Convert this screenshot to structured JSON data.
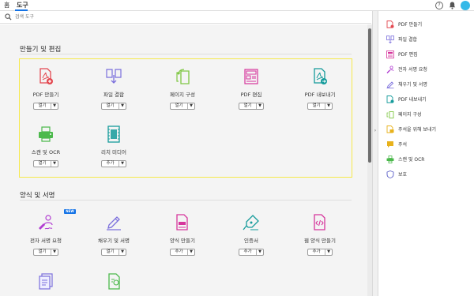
{
  "topbar": {
    "tabs": [
      "홈",
      "도구"
    ],
    "help_symbol": "?",
    "notify_symbol": "🔔"
  },
  "search": {
    "placeholder": "검색 도구"
  },
  "sections": [
    {
      "title": "만들기 및 편집",
      "tools": [
        {
          "label": "PDF 만들기",
          "button": "열기",
          "icon": "create-pdf-icon",
          "color": "#e34850"
        },
        {
          "label": "파일 결합",
          "button": "열기",
          "icon": "combine-files-icon",
          "color": "#7b6fdc"
        },
        {
          "label": "페이지 구성",
          "button": "열기",
          "icon": "organize-pages-icon",
          "color": "#7fc743"
        },
        {
          "label": "PDF 편집",
          "button": "열기",
          "icon": "edit-pdf-icon",
          "color": "#d6359c"
        },
        {
          "label": "PDF 내보내기",
          "button": "열기",
          "icon": "export-pdf-icon",
          "color": "#159b9b"
        },
        {
          "label": "스캔 및 OCR",
          "button": "열기",
          "icon": "scan-ocr-icon",
          "color": "#4cb94c"
        },
        {
          "label": "리치 미디어",
          "button": "추가",
          "icon": "rich-media-icon",
          "color": "#159b9b"
        }
      ]
    },
    {
      "title": "양식 및 서명",
      "tools": [
        {
          "label": "전자 서명 요청",
          "button": "열기",
          "icon": "request-signature-icon",
          "color": "#b13ed1",
          "badge": "NEW"
        },
        {
          "label": "채우기 및 서명",
          "button": "열기",
          "icon": "fill-sign-icon",
          "color": "#7b6fdc"
        },
        {
          "label": "양식 만들기",
          "button": "추가",
          "icon": "prepare-form-icon",
          "color": "#d6359c"
        },
        {
          "label": "인증서",
          "button": "추가",
          "icon": "certificates-icon",
          "color": "#159b9b"
        },
        {
          "label": "웹 양식 만들기",
          "button": "추가",
          "icon": "web-form-icon",
          "color": "#d6359c"
        }
      ]
    }
  ],
  "right_panel": [
    {
      "label": "PDF 만들기",
      "icon": "create-pdf-icon",
      "color": "#e34850"
    },
    {
      "label": "파일 결합",
      "icon": "combine-files-icon",
      "color": "#7b6fdc"
    },
    {
      "label": "PDF 편집",
      "icon": "edit-pdf-icon",
      "color": "#d6359c"
    },
    {
      "label": "전자 서명 요청",
      "icon": "request-signature-icon",
      "color": "#b13ed1"
    },
    {
      "label": "채우기 및 서명",
      "icon": "fill-sign-icon",
      "color": "#7b6fdc"
    },
    {
      "label": "PDF 내보내기",
      "icon": "export-pdf-icon",
      "color": "#159b9b"
    },
    {
      "label": "페이지 구성",
      "icon": "organize-pages-icon",
      "color": "#7fc743"
    },
    {
      "label": "주석을 위해 보내기",
      "icon": "send-comments-icon",
      "color": "#e8b21c"
    },
    {
      "label": "주석",
      "icon": "comment-icon",
      "color": "#e8b21c"
    },
    {
      "label": "스캔 및 OCR",
      "icon": "scan-ocr-icon",
      "color": "#4cb94c"
    },
    {
      "label": "보호",
      "icon": "protect-icon",
      "color": "#5b5fc7"
    }
  ]
}
